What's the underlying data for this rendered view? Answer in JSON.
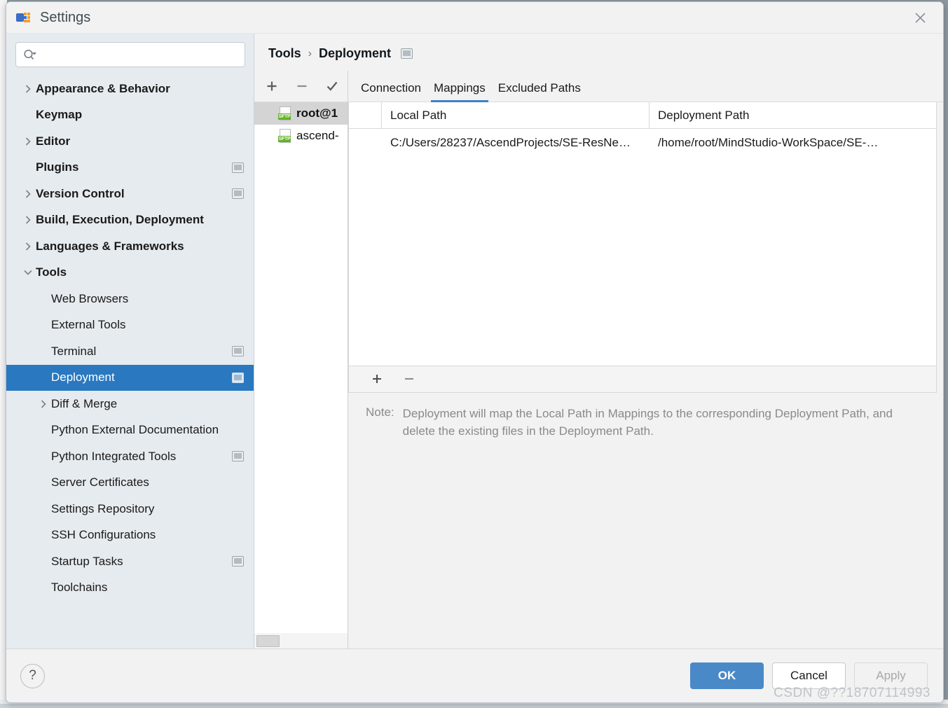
{
  "window": {
    "title": "Settings",
    "app_icon": "pycharm-icon",
    "close_icon": "close-icon"
  },
  "search": {
    "value": "",
    "placeholder": "",
    "icon": "search-icon"
  },
  "sidebar": {
    "items": [
      {
        "label": "Appearance & Behavior",
        "level": 0,
        "arrow": "collapsed",
        "badge": false,
        "selected": false
      },
      {
        "label": "Keymap",
        "level": 0,
        "arrow": "none",
        "badge": false,
        "selected": false
      },
      {
        "label": "Editor",
        "level": 0,
        "arrow": "collapsed",
        "badge": false,
        "selected": false
      },
      {
        "label": "Plugins",
        "level": 0,
        "arrow": "none",
        "badge": true,
        "selected": false
      },
      {
        "label": "Version Control",
        "level": 0,
        "arrow": "collapsed",
        "badge": true,
        "selected": false
      },
      {
        "label": "Build, Execution, Deployment",
        "level": 0,
        "arrow": "collapsed",
        "badge": false,
        "selected": false
      },
      {
        "label": "Languages & Frameworks",
        "level": 0,
        "arrow": "collapsed",
        "badge": false,
        "selected": false
      },
      {
        "label": "Tools",
        "level": 0,
        "arrow": "expanded",
        "badge": false,
        "selected": false
      },
      {
        "label": "Web Browsers",
        "level": 1,
        "arrow": "none",
        "badge": false,
        "selected": false
      },
      {
        "label": "External Tools",
        "level": 1,
        "arrow": "none",
        "badge": false,
        "selected": false
      },
      {
        "label": "Terminal",
        "level": 1,
        "arrow": "none",
        "badge": true,
        "selected": false
      },
      {
        "label": "Deployment",
        "level": 1,
        "arrow": "none",
        "badge": true,
        "selected": true
      },
      {
        "label": "Diff & Merge",
        "level": 1,
        "arrow": "collapsed",
        "badge": false,
        "selected": false
      },
      {
        "label": "Python External Documentation",
        "level": 1,
        "arrow": "none",
        "badge": false,
        "selected": false
      },
      {
        "label": "Python Integrated Tools",
        "level": 1,
        "arrow": "none",
        "badge": true,
        "selected": false
      },
      {
        "label": "Server Certificates",
        "level": 1,
        "arrow": "none",
        "badge": false,
        "selected": false
      },
      {
        "label": "Settings Repository",
        "level": 1,
        "arrow": "none",
        "badge": false,
        "selected": false
      },
      {
        "label": "SSH Configurations",
        "level": 1,
        "arrow": "none",
        "badge": false,
        "selected": false
      },
      {
        "label": "Startup Tasks",
        "level": 1,
        "arrow": "none",
        "badge": true,
        "selected": false
      },
      {
        "label": "Toolchains",
        "level": 1,
        "arrow": "none",
        "badge": false,
        "selected": false
      }
    ]
  },
  "breadcrumb": {
    "parent": "Tools",
    "separator": "›",
    "current": "Deployment",
    "badge_icon": "project-scope-badge-icon"
  },
  "server_toolbar": {
    "add_icon": "plus-icon",
    "remove_icon": "minus-icon",
    "set_default_icon": "check-icon"
  },
  "servers": [
    {
      "name": "root@1",
      "type": "SFTP",
      "selected": true
    },
    {
      "name": "ascend-",
      "type": "SFTP",
      "selected": false
    }
  ],
  "tabs": [
    {
      "label": "Connection",
      "active": false
    },
    {
      "label": "Mappings",
      "active": true
    },
    {
      "label": "Excluded Paths",
      "active": false
    }
  ],
  "mappings_table": {
    "columns": [
      "",
      "Local Path",
      "Deployment Path"
    ],
    "rows": [
      {
        "marker": "",
        "local_path": "C:/Users/28237/AscendProjects/SE-ResNe…",
        "deployment_path": "/home/root/MindStudio-WorkSpace/SE-…"
      }
    ]
  },
  "table_toolbar": {
    "add_icon": "plus-icon",
    "remove_icon": "minus-icon"
  },
  "note": {
    "label": "Note:",
    "text": "Deployment will map the Local Path in Mappings to the corresponding Deployment Path, and delete the existing files in the Deployment Path."
  },
  "footer": {
    "help_label": "?",
    "ok_label": "OK",
    "cancel_label": "Cancel",
    "apply_label": "Apply"
  },
  "watermark": "CSDN @??18707114993",
  "colors": {
    "accent": "#2a78bf",
    "tab_underline": "#3c82c4",
    "primary_button": "#4a89c8",
    "sidebar_bg": "#e6ebef",
    "panel_bg": "#f2f2f2",
    "sftp_badge": "#63b22a"
  }
}
